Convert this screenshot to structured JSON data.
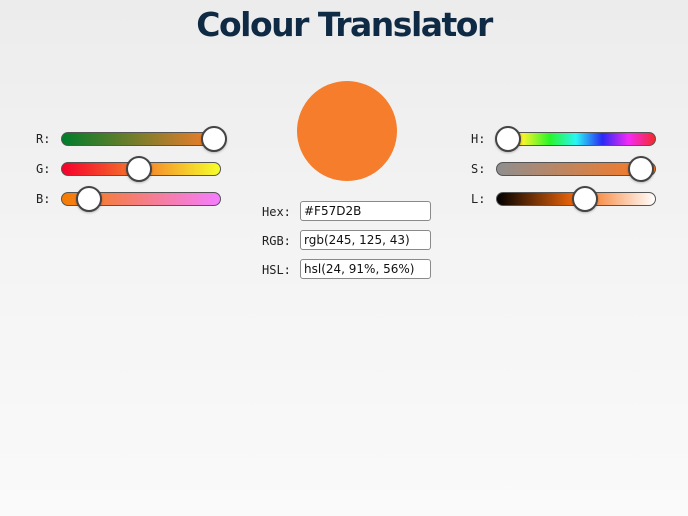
{
  "title": "Colour Translator",
  "colour": {
    "hex": "#F57D2B",
    "rgb": [
      245,
      125,
      43
    ],
    "hsl": [
      24,
      91,
      56
    ]
  },
  "rgb_sliders": [
    {
      "label": "R:",
      "value": 245,
      "max": 255
    },
    {
      "label": "G:",
      "value": 125,
      "max": 255
    },
    {
      "label": "B:",
      "value": 43,
      "max": 255
    }
  ],
  "hsl_sliders": [
    {
      "label": "H:",
      "value": 24,
      "max": 360
    },
    {
      "label": "S:",
      "value": 91,
      "max": 100
    },
    {
      "label": "L:",
      "value": 56,
      "max": 100
    }
  ],
  "fields": [
    {
      "label": "Hex:",
      "value": "#F57D2B"
    },
    {
      "label": "RGB:",
      "value": "rgb(245, 125, 43)"
    },
    {
      "label": "HSL:",
      "value": "hsl(24, 91%, 56%)"
    }
  ]
}
